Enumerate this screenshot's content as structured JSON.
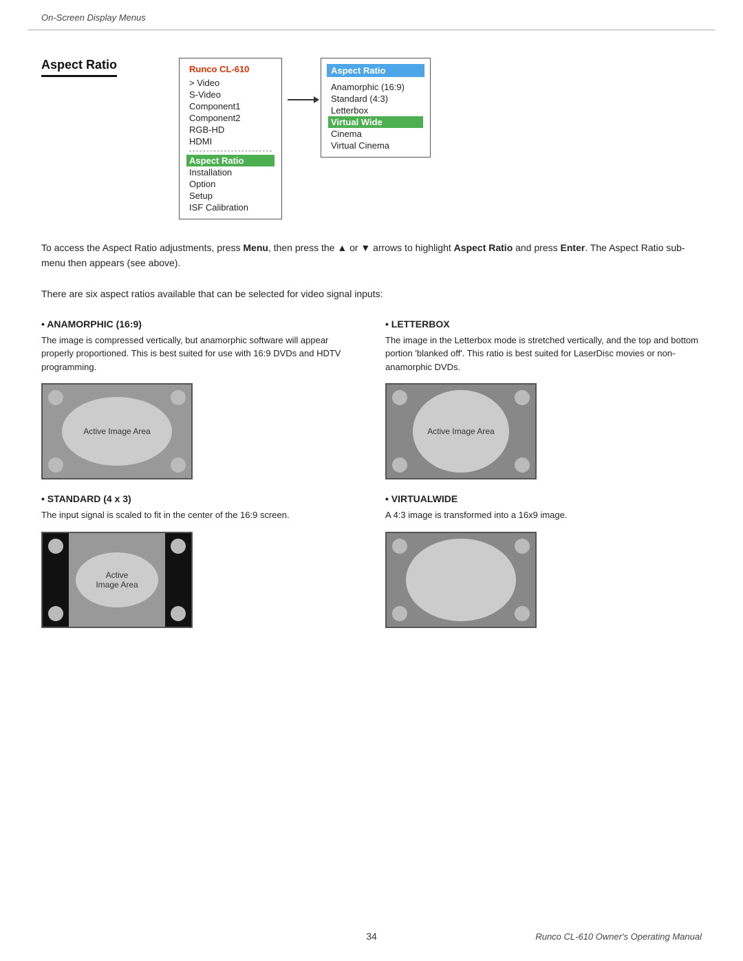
{
  "header": {
    "label": "On-Screen Display Menus"
  },
  "section": {
    "title": "Aspect Ratio"
  },
  "menu": {
    "title": "Runco CL-610",
    "items": [
      {
        "label": "Video",
        "arrow": true
      },
      {
        "label": "S-Video"
      },
      {
        "label": "Component1"
      },
      {
        "label": "Component2"
      },
      {
        "label": "RGB-HD"
      },
      {
        "label": "HDMI"
      }
    ],
    "selected": "Aspect Ratio",
    "sub_items": [
      {
        "label": "Installation"
      },
      {
        "label": "Option"
      },
      {
        "label": "Setup"
      },
      {
        "label": "ISF Calibration"
      }
    ]
  },
  "submenu": {
    "title": "Aspect Ratio",
    "items": [
      {
        "label": "Anamorphic (16:9)"
      },
      {
        "label": "Standard (4:3)"
      },
      {
        "label": "Letterbox"
      },
      {
        "label": "Virtual Wide",
        "selected": true
      },
      {
        "label": "Cinema"
      },
      {
        "label": "Virtual Cinema"
      }
    ]
  },
  "description": {
    "line1": "To access the Aspect Ratio adjustments, press Menu, then press the ▲ or ▼ arrows to highlight Aspect Ratio and press Enter. The Aspect Ratio sub-menu then appears (see above).",
    "line2": "There are six aspect ratios available that can be selected for video signal inputs:"
  },
  "aspects": [
    {
      "id": "anamorphic",
      "heading": "• ANAMORPHIC (16:9)",
      "desc": "The image is compressed vertically, but anamorphic software will appear properly proportioned. This is best suited for use with 16:9 DVDs and HDTV programming.",
      "active_label": "Active Image Area"
    },
    {
      "id": "letterbox",
      "heading": "• LETTERBOX",
      "desc": "The image in the Letterbox mode is stretched vertically, and the top and bottom portion 'blanked off'. This ratio is best suited for LaserDisc movies or non-anamorphic DVDs.",
      "active_label": "Active Image Area"
    },
    {
      "id": "standard",
      "heading": "• STANDARD (4 x 3)",
      "desc": "The input signal is scaled to fit in the center of the 16:9 screen.",
      "active_label": "Active\nImage Area"
    },
    {
      "id": "virtualwide",
      "heading": "• VIRTUALWIDE",
      "desc": "A 4:3 image is transformed into a 16x9 image.",
      "active_label": ""
    }
  ],
  "footer": {
    "page_number": "34",
    "right_text": "Runco CL-610 Owner's Operating Manual"
  }
}
